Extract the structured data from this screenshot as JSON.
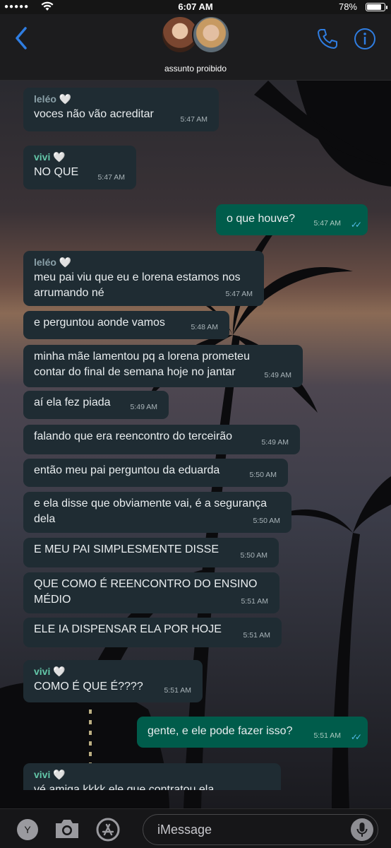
{
  "status_bar": {
    "signal": "●●●●●",
    "time": "6:07 AM",
    "battery": "78%"
  },
  "header": {
    "group_name": "assunto proibido"
  },
  "messages": [
    {
      "sender": "leléo",
      "heart": "🤍",
      "text": "voces não vão acreditar",
      "time": "5:47 AM"
    },
    {
      "sender": "vivi",
      "heart": "🤍",
      "text": "NO QUE",
      "time": "5:47 AM"
    },
    {
      "text": "o que houve?",
      "time": "5:47 AM",
      "ticks": "✓✓"
    },
    {
      "sender": "leléo",
      "heart": "🤍",
      "text": "meu pai viu que eu e lorena estamos nos arrumando né",
      "time": "5:47 AM"
    },
    {
      "text": "e perguntou aonde vamos",
      "time": "5:48 AM"
    },
    {
      "text": "minha mãe lamentou pq a lorena prometeu contar do final de semana hoje no jantar",
      "time": "5:49 AM"
    },
    {
      "text": "aí ela fez piada",
      "time": "5:49 AM"
    },
    {
      "text": "falando que era reencontro do terceirão",
      "time": "5:49 AM"
    },
    {
      "text": "então meu pai perguntou da eduarda",
      "time": "5:50 AM"
    },
    {
      "text": "e ela disse que obviamente vai, é a segurança dela",
      "time": "5:50 AM"
    },
    {
      "text": "E MEU PAI SIMPLESMENTE DISSE",
      "time": "5:50 AM"
    },
    {
      "text": "QUE COMO É REENCONTRO DO ENSINO MÉDIO",
      "time": "5:51 AM"
    },
    {
      "text": "ELE IA DISPENSAR ELA POR HOJE",
      "time": "5:51 AM"
    },
    {
      "sender": "vivi",
      "heart": "🤍",
      "text": "COMO É QUE É????",
      "time": "5:51 AM"
    },
    {
      "text": "gente, e ele pode fazer isso?",
      "time": "5:51 AM",
      "ticks": "✓✓"
    },
    {
      "sender": "vivi",
      "heart": "🤍",
      "text": "vé amiga kkkk ele que contratou ela"
    }
  ],
  "input_bar": {
    "avatar_letter": "Y",
    "placeholder": "iMessage"
  },
  "colors": {
    "accent": "#2f7de1",
    "incoming_bubble": "#1f2c33",
    "outgoing_bubble": "#005c4b",
    "ticks": "#53bdeb"
  }
}
